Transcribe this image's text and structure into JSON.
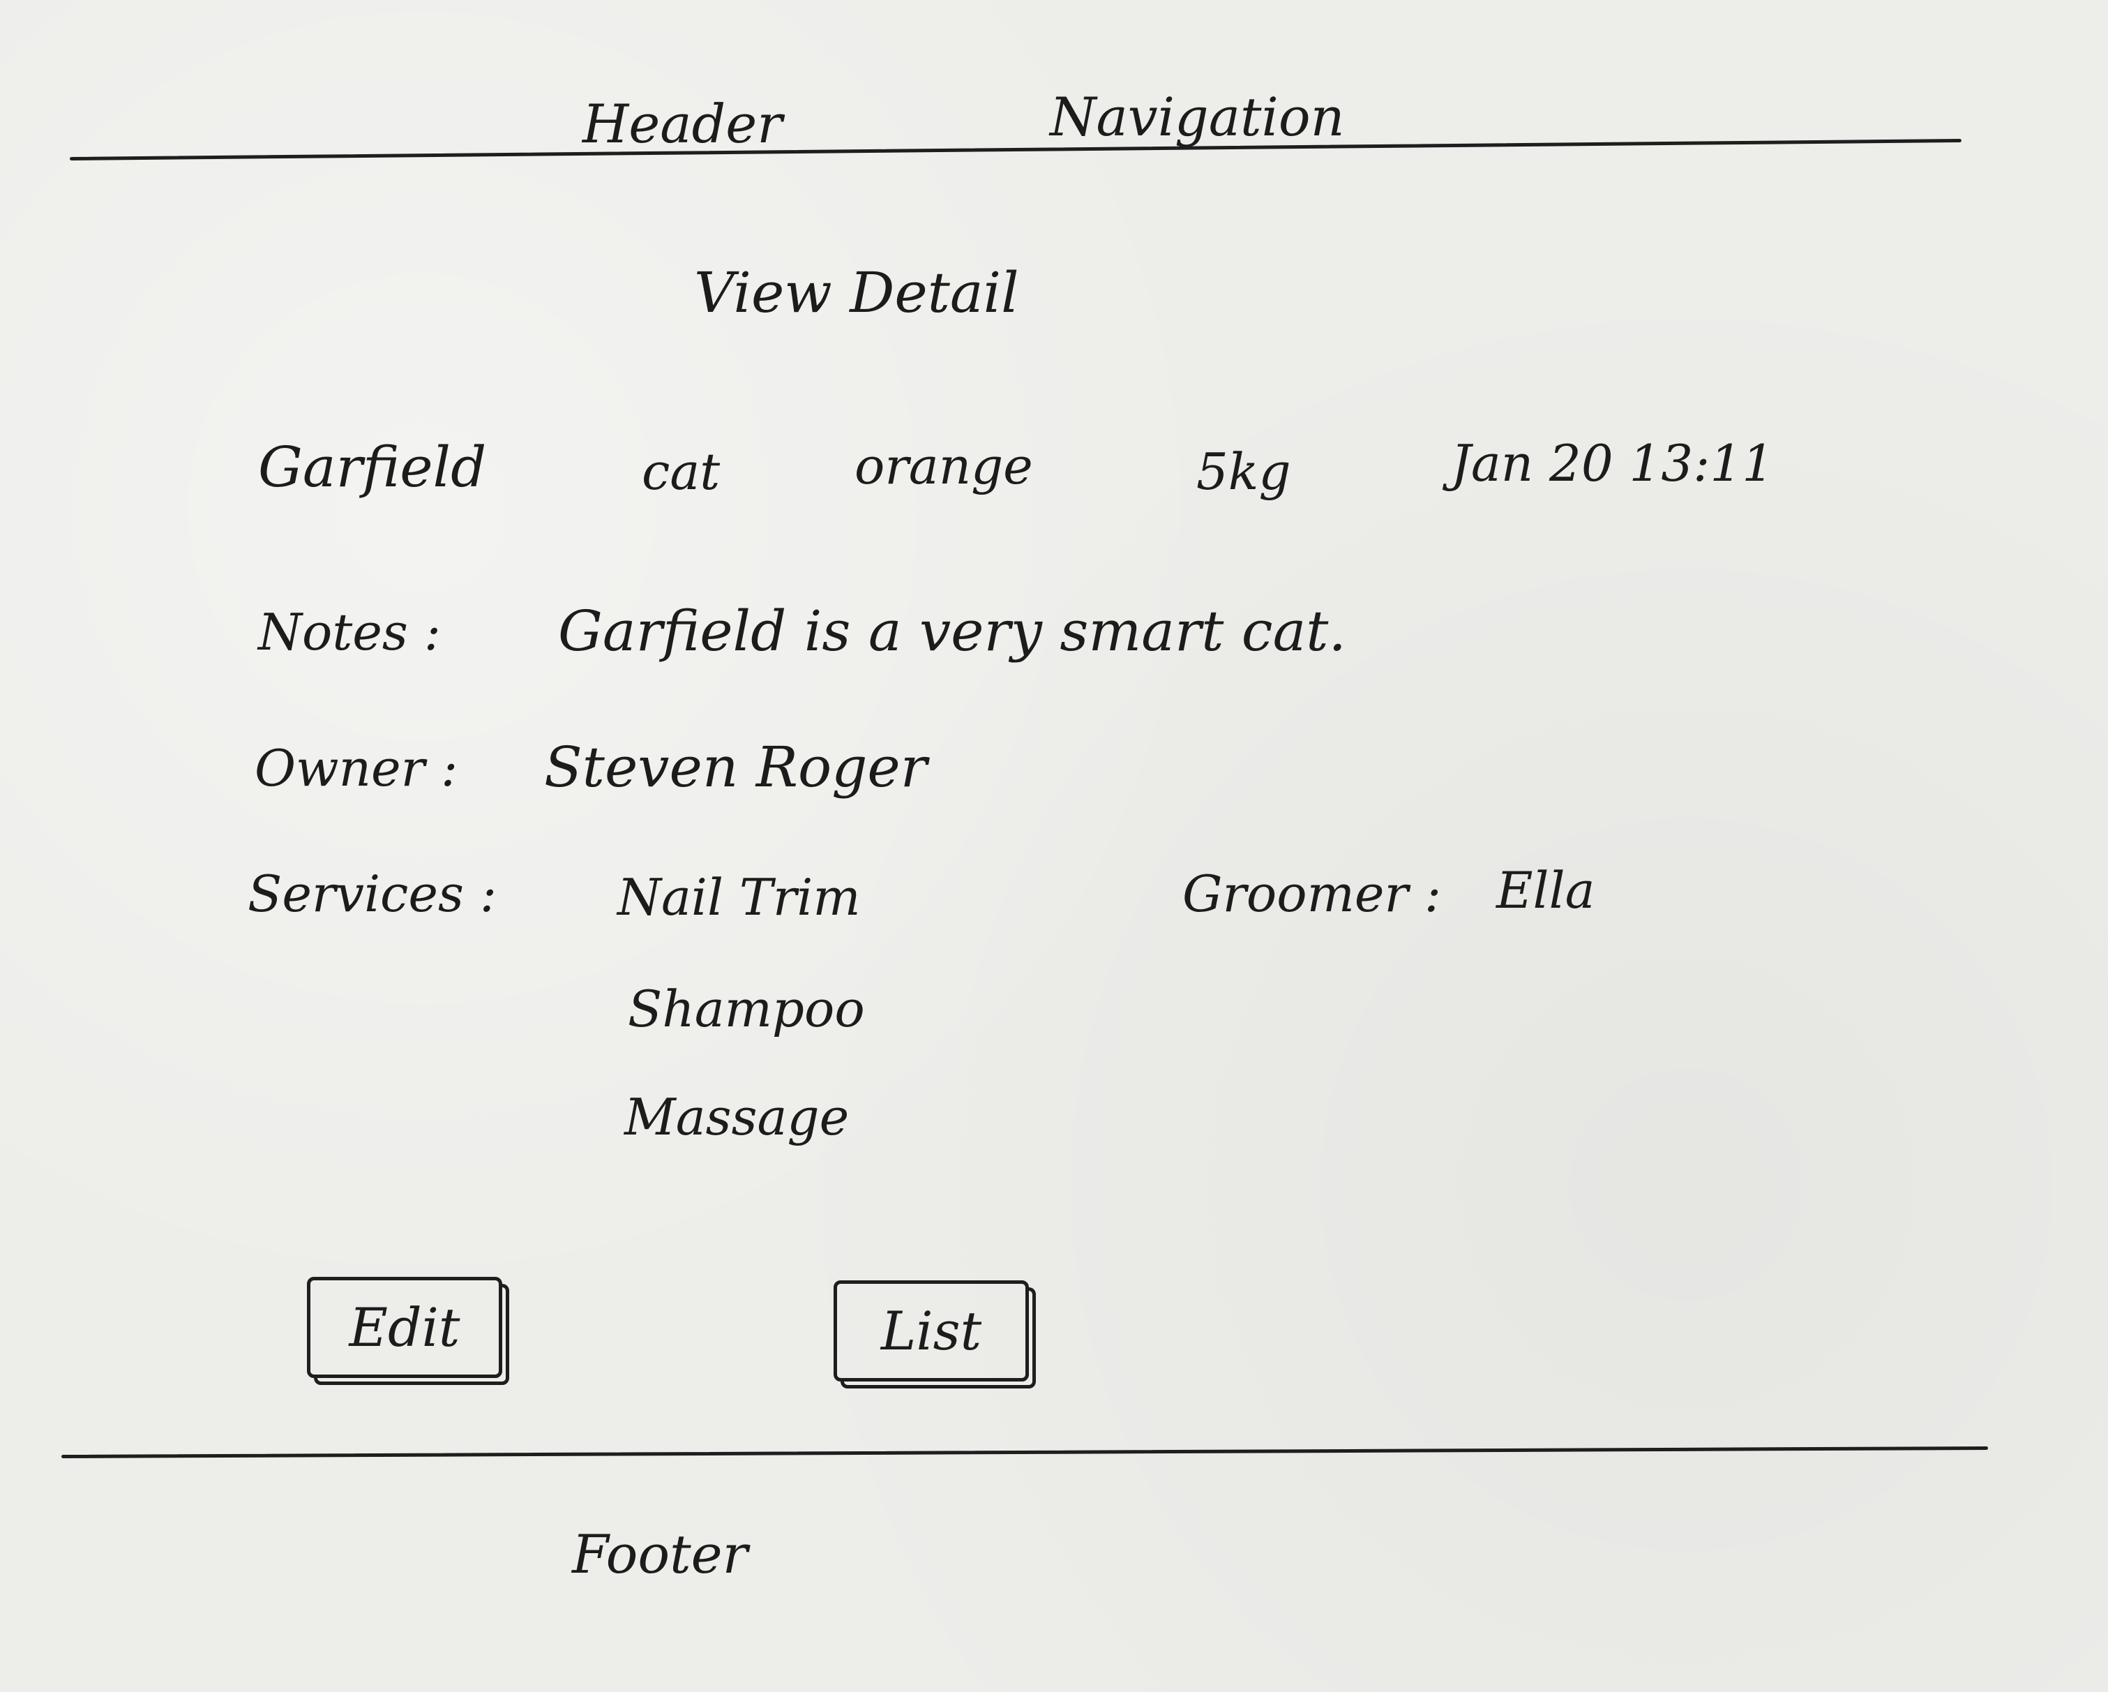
{
  "header": {
    "title": "Header",
    "navigation_label": "Navigation"
  },
  "page": {
    "title": "View Detail"
  },
  "summary": {
    "name": "Garfield",
    "species": "cat",
    "color": "orange",
    "weight": "5kg",
    "datetime": "Jan 20 13:11"
  },
  "details": {
    "notes_label": "Notes :",
    "notes_value": "Garfield is a very smart cat.",
    "owner_label": "Owner :",
    "owner_value": "Steven Roger",
    "services_label": "Services :",
    "services": [
      "Nail Trim",
      "Shampoo",
      "Massage"
    ],
    "groomer_label": "Groomer :",
    "groomer_value": "Ella"
  },
  "actions": {
    "edit_label": "Edit",
    "list_label": "List"
  },
  "footer": {
    "text": "Footer"
  }
}
